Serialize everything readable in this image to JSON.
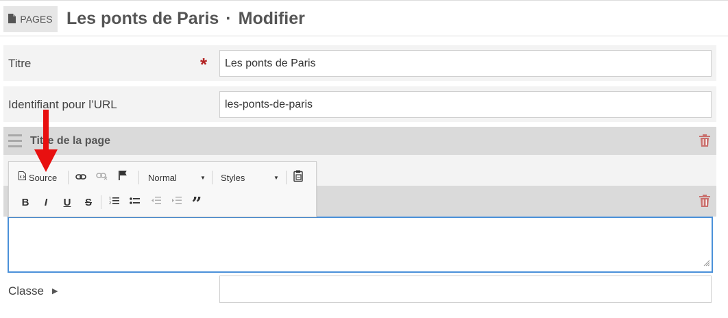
{
  "header": {
    "badge_label": "PAGES",
    "title": "Les ponts de Paris",
    "separator": "·",
    "action": "Modifier"
  },
  "form": {
    "title_field": {
      "label": "Titre",
      "required_mark": "*",
      "value": "Les ponts de Paris"
    },
    "slug_field": {
      "label": "Identifiant pour l’URL",
      "value": "les-ponts-de-paris"
    },
    "block": {
      "title": "Titre de la page"
    },
    "classe": {
      "label": "Classe",
      "value": ""
    }
  },
  "toolbar": {
    "source_label": "Source",
    "format_select": "Normal",
    "styles_select": "Styles",
    "bold": "B",
    "italic": "I",
    "underline": "U",
    "strike": "S",
    "blockquote": "”"
  },
  "colors": {
    "required": "#b22222",
    "trash": "#c9706d",
    "editor_focus": "#4a90d9",
    "arrow": "#e81010"
  },
  "icons": [
    "file-icon",
    "source-icon",
    "link-icon",
    "unlink-icon",
    "anchor-flag-icon",
    "paste-icon",
    "numbered-list-icon",
    "bulleted-list-icon",
    "outdent-icon",
    "indent-icon",
    "trash-icon",
    "drag-handle-icon"
  ]
}
